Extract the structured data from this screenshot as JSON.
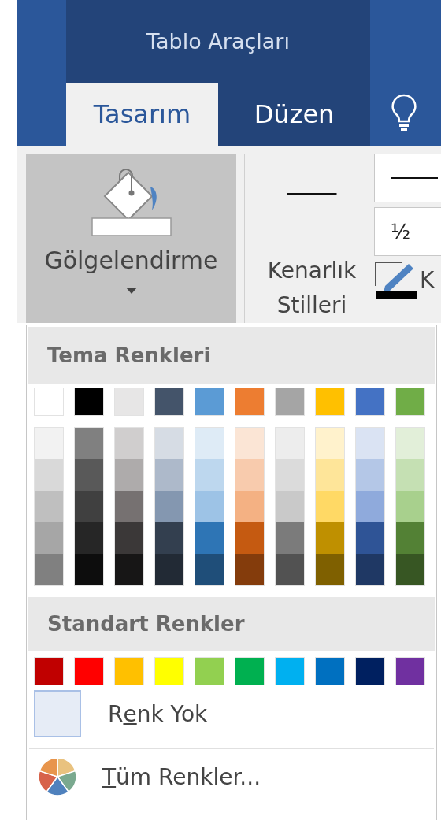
{
  "title_bar": {
    "contextual_title": "Tablo Araçları"
  },
  "tabs": [
    {
      "label": "Tasarım",
      "selected": true
    },
    {
      "label": "Düzen",
      "selected": false
    }
  ],
  "ribbon": {
    "shading_button": {
      "label": "Gölgelendirme",
      "pressed": true
    },
    "border_styles": {
      "label_lines": [
        "Kenarlık",
        "Stilleri"
      ]
    },
    "pen_weight": "½",
    "pen_color_label": "K"
  },
  "dropdown": {
    "theme_header": "Tema Renkleri",
    "theme_colors": [
      {
        "color": "#ffffff",
        "shades": [
          {
            "color": "#f2f2f2"
          },
          {
            "color": "#d9d9d9"
          },
          {
            "color": "#bfbfbf"
          },
          {
            "color": "#a6a6a6"
          },
          {
            "color": "#808080"
          }
        ]
      },
      {
        "color": "#000000",
        "shades": [
          {
            "color": "#808080"
          },
          {
            "color": "#595959"
          },
          {
            "color": "#404040"
          },
          {
            "color": "#262626"
          },
          {
            "color": "#0d0d0d"
          }
        ]
      },
      {
        "color": "#e7e6e6",
        "shades": [
          {
            "color": "#d0cece"
          },
          {
            "color": "#aeabab"
          },
          {
            "color": "#767171"
          },
          {
            "color": "#3b3838"
          },
          {
            "color": "#171616"
          }
        ]
      },
      {
        "color": "#44546a",
        "shades": [
          {
            "color": "#d6dce4"
          },
          {
            "color": "#adb9ca"
          },
          {
            "color": "#8497b0"
          },
          {
            "color": "#333f4f"
          },
          {
            "color": "#222a35"
          }
        ]
      },
      {
        "color": "#5b9bd5",
        "shades": [
          {
            "color": "#deebf6"
          },
          {
            "color": "#bdd7ee"
          },
          {
            "color": "#9dc3e6"
          },
          {
            "color": "#2e75b5"
          },
          {
            "color": "#1f4e79"
          }
        ]
      },
      {
        "color": "#ed7d31",
        "shades": [
          {
            "color": "#fbe5d5"
          },
          {
            "color": "#f8cbad"
          },
          {
            "color": "#f4b183"
          },
          {
            "color": "#c55a11"
          },
          {
            "color": "#843c0c"
          }
        ]
      },
      {
        "color": "#a5a5a5",
        "shades": [
          {
            "color": "#ededed"
          },
          {
            "color": "#dbdbdb"
          },
          {
            "color": "#c9c9c9"
          },
          {
            "color": "#7b7b7b"
          },
          {
            "color": "#525252"
          }
        ]
      },
      {
        "color": "#ffc000",
        "shades": [
          {
            "color": "#fff2cc"
          },
          {
            "color": "#fee599"
          },
          {
            "color": "#ffd965"
          },
          {
            "color": "#bf9000"
          },
          {
            "color": "#7f6000"
          }
        ]
      },
      {
        "color": "#4472c4",
        "shades": [
          {
            "color": "#dae3f3"
          },
          {
            "color": "#b4c7e7"
          },
          {
            "color": "#8faadc"
          },
          {
            "color": "#2f5496"
          },
          {
            "color": "#1f3864"
          }
        ]
      },
      {
        "color": "#70ad47",
        "shades": [
          {
            "color": "#e2efd9"
          },
          {
            "color": "#c5e0b3"
          },
          {
            "color": "#a8d08d"
          },
          {
            "color": "#538135"
          },
          {
            "color": "#375623"
          }
        ]
      }
    ],
    "standard_header": "Standart Renkler",
    "standard_colors": [
      {
        "color": "#c00000"
      },
      {
        "color": "#ff0000"
      },
      {
        "color": "#ffc000"
      },
      {
        "color": "#ffff00"
      },
      {
        "color": "#92d050"
      },
      {
        "color": "#00b050"
      },
      {
        "color": "#00b0f0"
      },
      {
        "color": "#0070c0"
      },
      {
        "color": "#002060"
      },
      {
        "color": "#7030a0"
      }
    ],
    "no_color": {
      "label_parts": [
        {
          "text": "R",
          "underlined": false
        },
        {
          "text": "e",
          "underlined": true
        },
        {
          "text": "nk Yok",
          "underlined": false
        }
      ]
    },
    "more_colors": {
      "label_parts": [
        {
          "text": "T",
          "underlined": true
        },
        {
          "text": "üm Renkler...",
          "underlined": false
        }
      ]
    }
  }
}
